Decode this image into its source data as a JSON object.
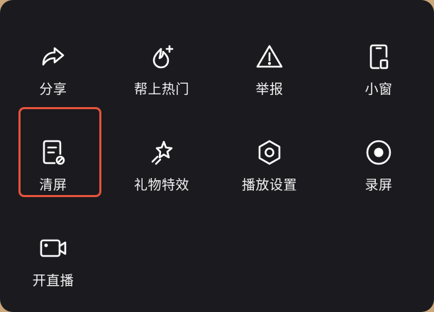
{
  "menu": {
    "items": [
      {
        "label": "分享",
        "icon": "share-icon"
      },
      {
        "label": "帮上热门",
        "icon": "boost-flame-icon"
      },
      {
        "label": "举报",
        "icon": "warning-icon"
      },
      {
        "label": "小窗",
        "icon": "mini-window-icon"
      },
      {
        "label": "清屏",
        "icon": "clear-screen-icon"
      },
      {
        "label": "礼物特效",
        "icon": "gift-effect-icon"
      },
      {
        "label": "播放设置",
        "icon": "settings-hex-icon"
      },
      {
        "label": "录屏",
        "icon": "record-icon"
      },
      {
        "label": "开直播",
        "icon": "live-camera-icon"
      }
    ]
  },
  "colors": {
    "panel_bg": "#1a1a1f",
    "icon": "#ffffff",
    "label": "#f2f2f2",
    "highlight": "#e4533a"
  }
}
